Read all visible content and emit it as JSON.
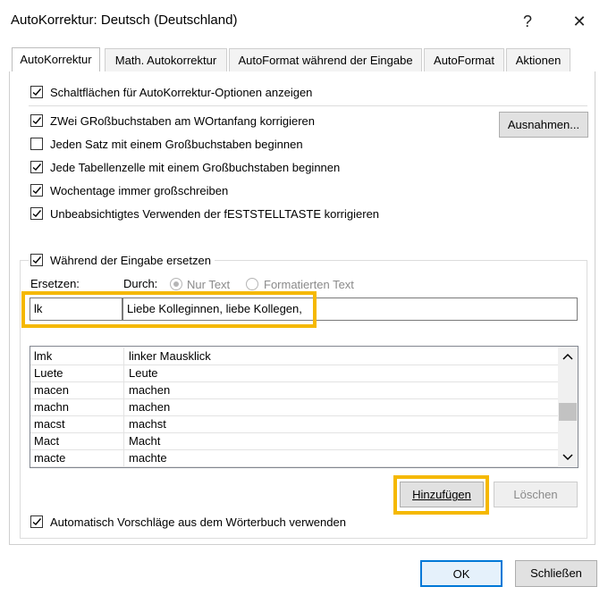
{
  "window": {
    "title": "AutoKorrektur: Deutsch (Deutschland)",
    "help_label": "?",
    "close_label": "✕"
  },
  "tabs": [
    {
      "label": "AutoKorrektur",
      "active": true
    },
    {
      "label": "Math. Autokorrektur",
      "active": false
    },
    {
      "label": "AutoFormat während der Eingabe",
      "active": false
    },
    {
      "label": "AutoFormat",
      "active": false
    },
    {
      "label": "Aktionen",
      "active": false
    }
  ],
  "options": [
    {
      "label": "Schaltflächen für AutoKorrektur-Optionen anzeigen",
      "checked": true
    },
    {
      "label": "ZWei GRoßbuchstaben am WOrtanfang korrigieren",
      "checked": true
    },
    {
      "label": "Jeden Satz mit einem Großbuchstaben beginnen",
      "checked": false
    },
    {
      "label": "Jede Tabellenzelle mit einem Großbuchstaben beginnen",
      "checked": true
    },
    {
      "label": "Wochentage immer großschreiben",
      "checked": true
    },
    {
      "label": "Unbeabsichtigtes Verwenden der fESTSTELLTASTE korrigieren",
      "checked": true
    }
  ],
  "exceptions_button": "Ausnahmen...",
  "replace_group": {
    "checkbox_label": "Während der Eingabe ersetzen",
    "checked": true,
    "replace_label": "Ersetzen:",
    "with_label": "Durch:",
    "radio_plain": "Nur Text",
    "radio_formatted": "Formatierten Text",
    "replace_value": "lk",
    "with_value": "Liebe Kolleginnen, liebe Kollegen,"
  },
  "entries": [
    {
      "from": "lmk",
      "to": "linker Mausklick"
    },
    {
      "from": "Luete",
      "to": "Leute"
    },
    {
      "from": "macen",
      "to": "machen"
    },
    {
      "from": "machn",
      "to": "machen"
    },
    {
      "from": "macst",
      "to": "machst"
    },
    {
      "from": "Mact",
      "to": "Macht"
    },
    {
      "from": "macte",
      "to": "machte"
    }
  ],
  "add_button": "Hinzufügen",
  "delete_button": "Löschen",
  "dictionary_option": {
    "label": "Automatisch Vorschläge aus dem Wörterbuch verwenden",
    "checked": true
  },
  "ok_button": "OK",
  "close_button": "Schließen"
}
